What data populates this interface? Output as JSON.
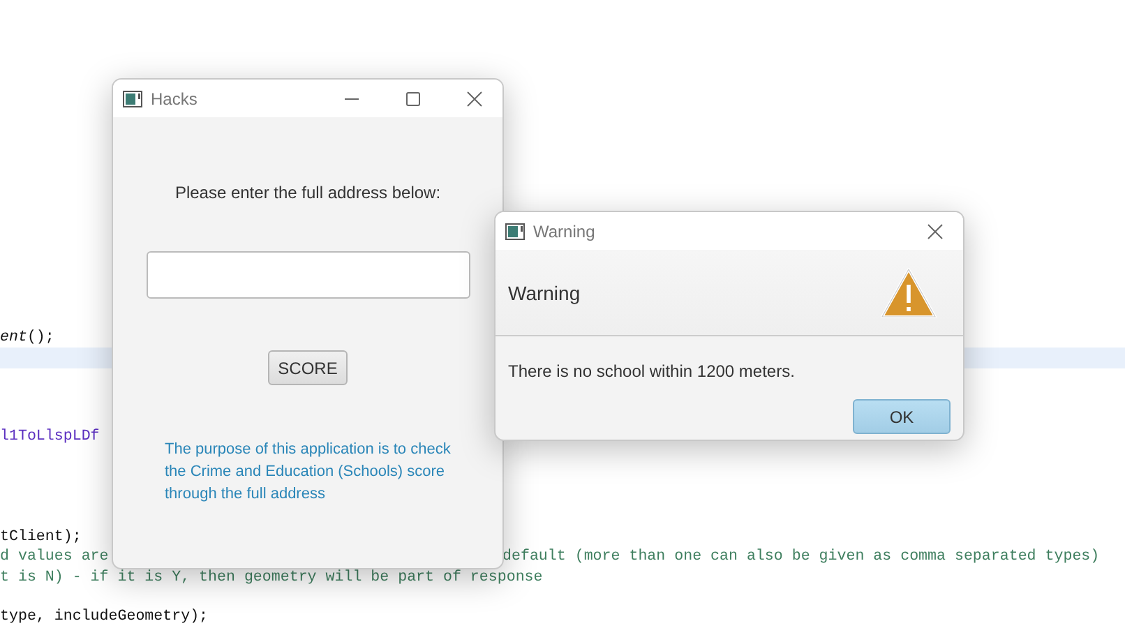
{
  "code_lines": [
    {
      "kind": "code",
      "fragments": [
        "*ent*();"
      ]
    },
    {
      "kind": "current-line"
    },
    {
      "kind": "blank"
    },
    {
      "kind": "blank"
    },
    {
      "kind": "blank"
    },
    {
      "kind": "field",
      "fragments": [
        "l1ToLlspLDf"
      ]
    },
    {
      "kind": "blank"
    },
    {
      "kind": "blank"
    },
    {
      "kind": "blank"
    },
    {
      "kind": "blank"
    },
    {
      "kind": "code",
      "fragments": [
        "tClient);"
      ]
    },
    {
      "kind": "comment",
      "fragments": [
        "d values are",
        "default (more than one can also be given as comma separated types)"
      ]
    },
    {
      "kind": "comment",
      "fragments": [
        "t is N) - if it is Y, then geometry will be part of response"
      ]
    },
    {
      "kind": "blank"
    },
    {
      "kind": "code",
      "fragments": [
        "type, includeGeometry);"
      ]
    }
  ],
  "main_window": {
    "title": "Hacks",
    "prompt": "Please enter the full address below:",
    "score_button": "SCORE",
    "description": "The purpose of this application is to check the Crime and Education (Schools) score through the full address"
  },
  "warning_dialog": {
    "title": "Warning",
    "header": "Warning",
    "message": "There is no school within 1200 meters.",
    "ok_button": "OK"
  }
}
